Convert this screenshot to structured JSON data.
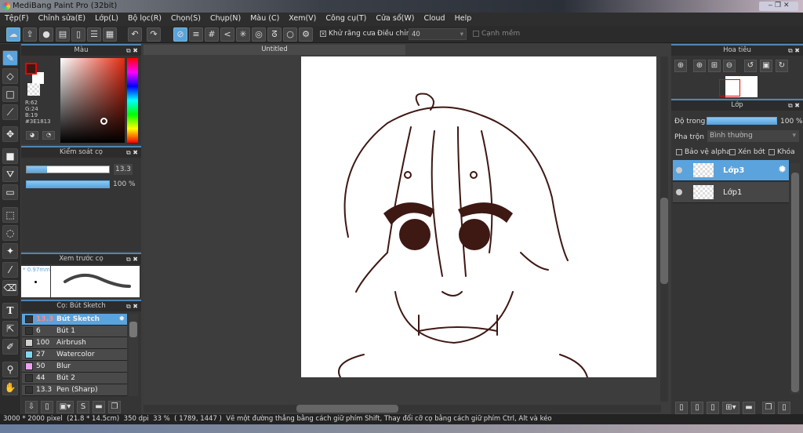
{
  "window": {
    "title": "MediBang Paint Pro (32bit)"
  },
  "menu": [
    "Tệp(F)",
    "Chỉnh sửa(E)",
    "Lớp(L)",
    "Bộ lọc(R)",
    "Chọn(S)",
    "Chụp(N)",
    "Màu (C)",
    "Xem(V)",
    "Công cụ(T)",
    "Cửa sổ(W)",
    "Cloud",
    "Help"
  ],
  "toolbar": {
    "antialias_label": "Khử răng cưa",
    "antialias_checked": true,
    "adjust_label": "Điều chỉnh",
    "adjust_value": "40",
    "soft_edge_label": "Cạnh mềm",
    "soft_edge_checked": false
  },
  "color_panel": {
    "title": "Màu",
    "r": "R:62",
    "g": "G:24",
    "b": "B:19",
    "hex": "#3E1813",
    "foreground": "#3e1813",
    "background": "#ffffff"
  },
  "brush_control": {
    "title": "Kiểm soát cọ",
    "size": "13.3",
    "opacity": "100 %",
    "size_fraction": 0.25,
    "opacity_fraction": 1.0
  },
  "brush_preview": {
    "title": "Xem trước cọ",
    "size": "* 0.97mm"
  },
  "brush_list": {
    "title": "Cọ: Bút Sketch",
    "items": [
      {
        "size": "13.3",
        "name": "Bút Sketch",
        "color": "#333333",
        "selected": true
      },
      {
        "size": "6",
        "name": "Bút 1",
        "color": "#333333"
      },
      {
        "size": "100",
        "name": "Airbrush",
        "color": "#d0d0d0"
      },
      {
        "size": "27",
        "name": "Watercolor",
        "color": "#7fd8f0"
      },
      {
        "size": "50",
        "name": "Blur",
        "color": "#f0a0f0"
      },
      {
        "size": "44",
        "name": "Bút 2",
        "color": "#333333"
      },
      {
        "size": "13.3",
        "name": "Pen (Sharp)",
        "color": "#333333"
      }
    ]
  },
  "canvas": {
    "tab": "Untitled"
  },
  "navigator": {
    "title": "Hoa tiêu"
  },
  "layers": {
    "title": "Lớp",
    "opacity_label": "Độ trong",
    "opacity_value": "100 %",
    "opacity_fraction": 1.0,
    "blend_label": "Pha trộn",
    "blend_value": "Bình thường",
    "protect_alpha": "Bảo vệ alpha",
    "clip": "Xén bớt",
    "lock": "Khóa",
    "items": [
      {
        "name": "Lớp3",
        "selected": true
      },
      {
        "name": "Lớp1",
        "selected": false
      }
    ]
  },
  "status": {
    "dimensions": "3000 * 2000 pixel",
    "physical": "(21.8 * 14.5cm)",
    "dpi": "350 dpi",
    "zoom": "33 %",
    "coords": "( 1789, 1447 )",
    "hint": "Vẽ một đường thẳng bằng cách giữ phím Shift, Thay đổi cỡ cọ bằng cách giữ phím Ctrl, Alt và kéo"
  }
}
